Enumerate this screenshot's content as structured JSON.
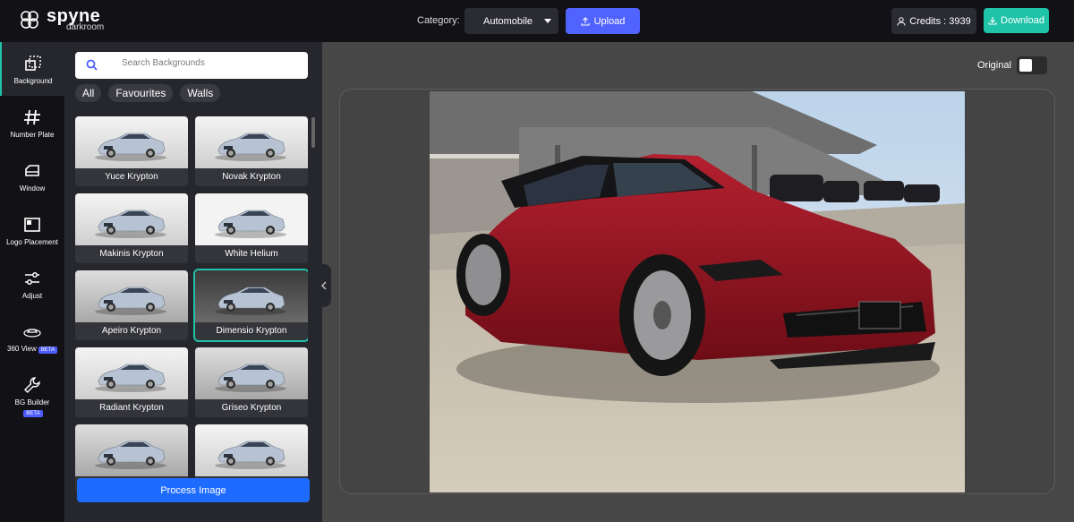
{
  "header": {
    "brand": "spyne",
    "brand_sub": "darkroom",
    "category_label": "Category:",
    "category_value": "Automobile",
    "upload_label": "Upload",
    "credits_label": "Credits : 3939",
    "download_label": "Download"
  },
  "nav": {
    "items": [
      {
        "label": "Background",
        "icon": "background-icon"
      },
      {
        "label": "Number Plate",
        "icon": "hash-icon"
      },
      {
        "label": "Window",
        "icon": "window-icon"
      },
      {
        "label": "Logo Placement",
        "icon": "logo-placement-icon"
      },
      {
        "label": "Adjust",
        "icon": "sliders-icon"
      },
      {
        "label": "360 View",
        "icon": "car-360-icon",
        "badge": "BETA"
      },
      {
        "label": "BG Builder",
        "icon": "wrench-icon",
        "badge": "BETA"
      }
    ],
    "active": "Background"
  },
  "panel": {
    "search_placeholder": "Search Backgrounds",
    "filters": [
      "All",
      "Favourites",
      "Walls"
    ],
    "backgrounds": [
      {
        "label": "Yuce Krypton"
      },
      {
        "label": "Novak Krypton"
      },
      {
        "label": "Makinis Krypton"
      },
      {
        "label": "White Helium"
      },
      {
        "label": "Apeiro Krypton"
      },
      {
        "label": "Dimensio Krypton"
      },
      {
        "label": "Radiant Krypton"
      },
      {
        "label": "Griseo Krypton"
      },
      {
        "label": ""
      },
      {
        "label": ""
      }
    ],
    "selected_background": "Dimensio Krypton",
    "process_label": "Process Image"
  },
  "canvas": {
    "original_label": "Original",
    "original_toggle_on": false
  },
  "colors": {
    "accent_teal": "#1fc3a8",
    "primary_blue": "#1e6bff",
    "upload_blue": "#5163ff",
    "car_red": "#9c1422"
  }
}
